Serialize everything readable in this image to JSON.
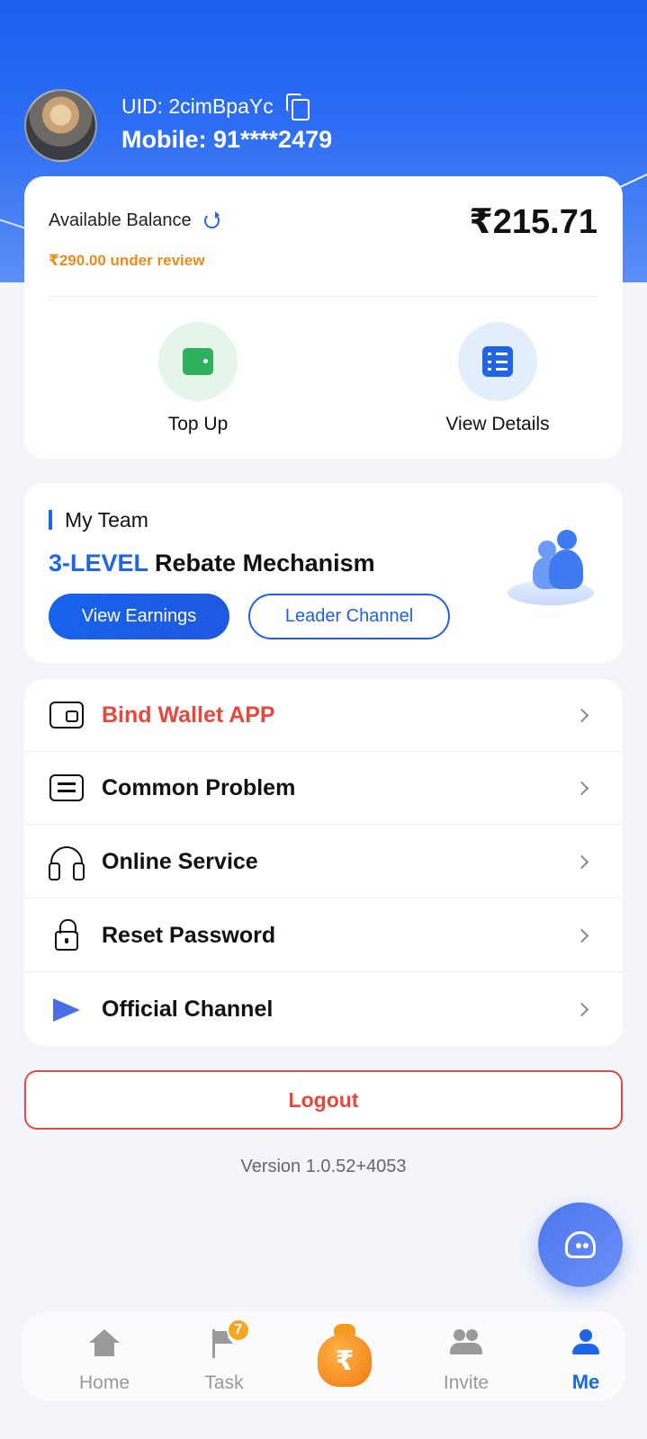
{
  "profile": {
    "uid": "UID: 2cimBpaYc",
    "mobile": "Mobile: 91****2479"
  },
  "balance": {
    "label": "Available Balance",
    "amount": "₹215.71",
    "review": "₹290.00 under review",
    "actions": [
      {
        "label": "Top Up",
        "icon": "wallet-icon"
      },
      {
        "label": "View Details",
        "icon": "list-icon"
      }
    ]
  },
  "team": {
    "title": "My Team",
    "rebate_highlight": "3-LEVEL",
    "rebate_text": "Rebate Mechanism",
    "earnings_button": "View Earnings",
    "leader_button": "Leader Channel"
  },
  "menu": [
    {
      "label": "Bind Wallet APP",
      "icon": "wallet-icon",
      "color": "#e8473b"
    },
    {
      "label": "Common Problem",
      "icon": "chat-icon"
    },
    {
      "label": "Online Service",
      "icon": "headset-icon"
    },
    {
      "label": "Reset Password",
      "icon": "lock-icon"
    },
    {
      "label": "Official Channel",
      "icon": "send-icon"
    }
  ],
  "logout": "Logout",
  "version": "Version 1.0.52+4053",
  "tabbar": {
    "items": [
      {
        "label": "Home",
        "icon": "home-icon"
      },
      {
        "label": "Task",
        "icon": "flag-icon",
        "badge": "7"
      },
      {
        "label": "",
        "icon": "money-bag-icon"
      },
      {
        "label": "Invite",
        "icon": "people-icon"
      },
      {
        "label": "Me",
        "icon": "person-icon",
        "active": true
      }
    ]
  },
  "colors": {
    "primary": "#1f66e6",
    "danger": "#e8473b",
    "warning": "#f08a1c"
  }
}
